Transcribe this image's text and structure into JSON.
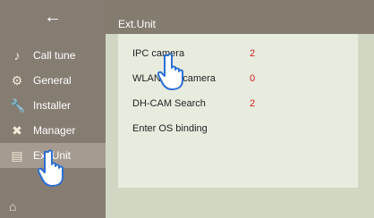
{
  "app": {
    "title": "Ext.Unit"
  },
  "sidebar": {
    "back_icon": "back-arrow-icon",
    "items": [
      {
        "label": "Call tune",
        "icon": "music-note-icon"
      },
      {
        "label": "General",
        "icon": "gear-icon"
      },
      {
        "label": "Installer",
        "icon": "wrench-icon"
      },
      {
        "label": "Manager",
        "icon": "tools-icon"
      },
      {
        "label": "Ext.Unit",
        "icon": "document-icon",
        "active": true
      }
    ],
    "home_icon": "home-icon"
  },
  "main": {
    "rows": [
      {
        "label": "IPC camera",
        "value": "2"
      },
      {
        "label": "WLAN IPC camera",
        "value": "0"
      },
      {
        "label": "DH-CAM Search",
        "value": "2"
      },
      {
        "label": "Enter OS binding",
        "value": ""
      }
    ]
  },
  "overlay": {
    "hand_icon": "pointing-hand-icon"
  }
}
